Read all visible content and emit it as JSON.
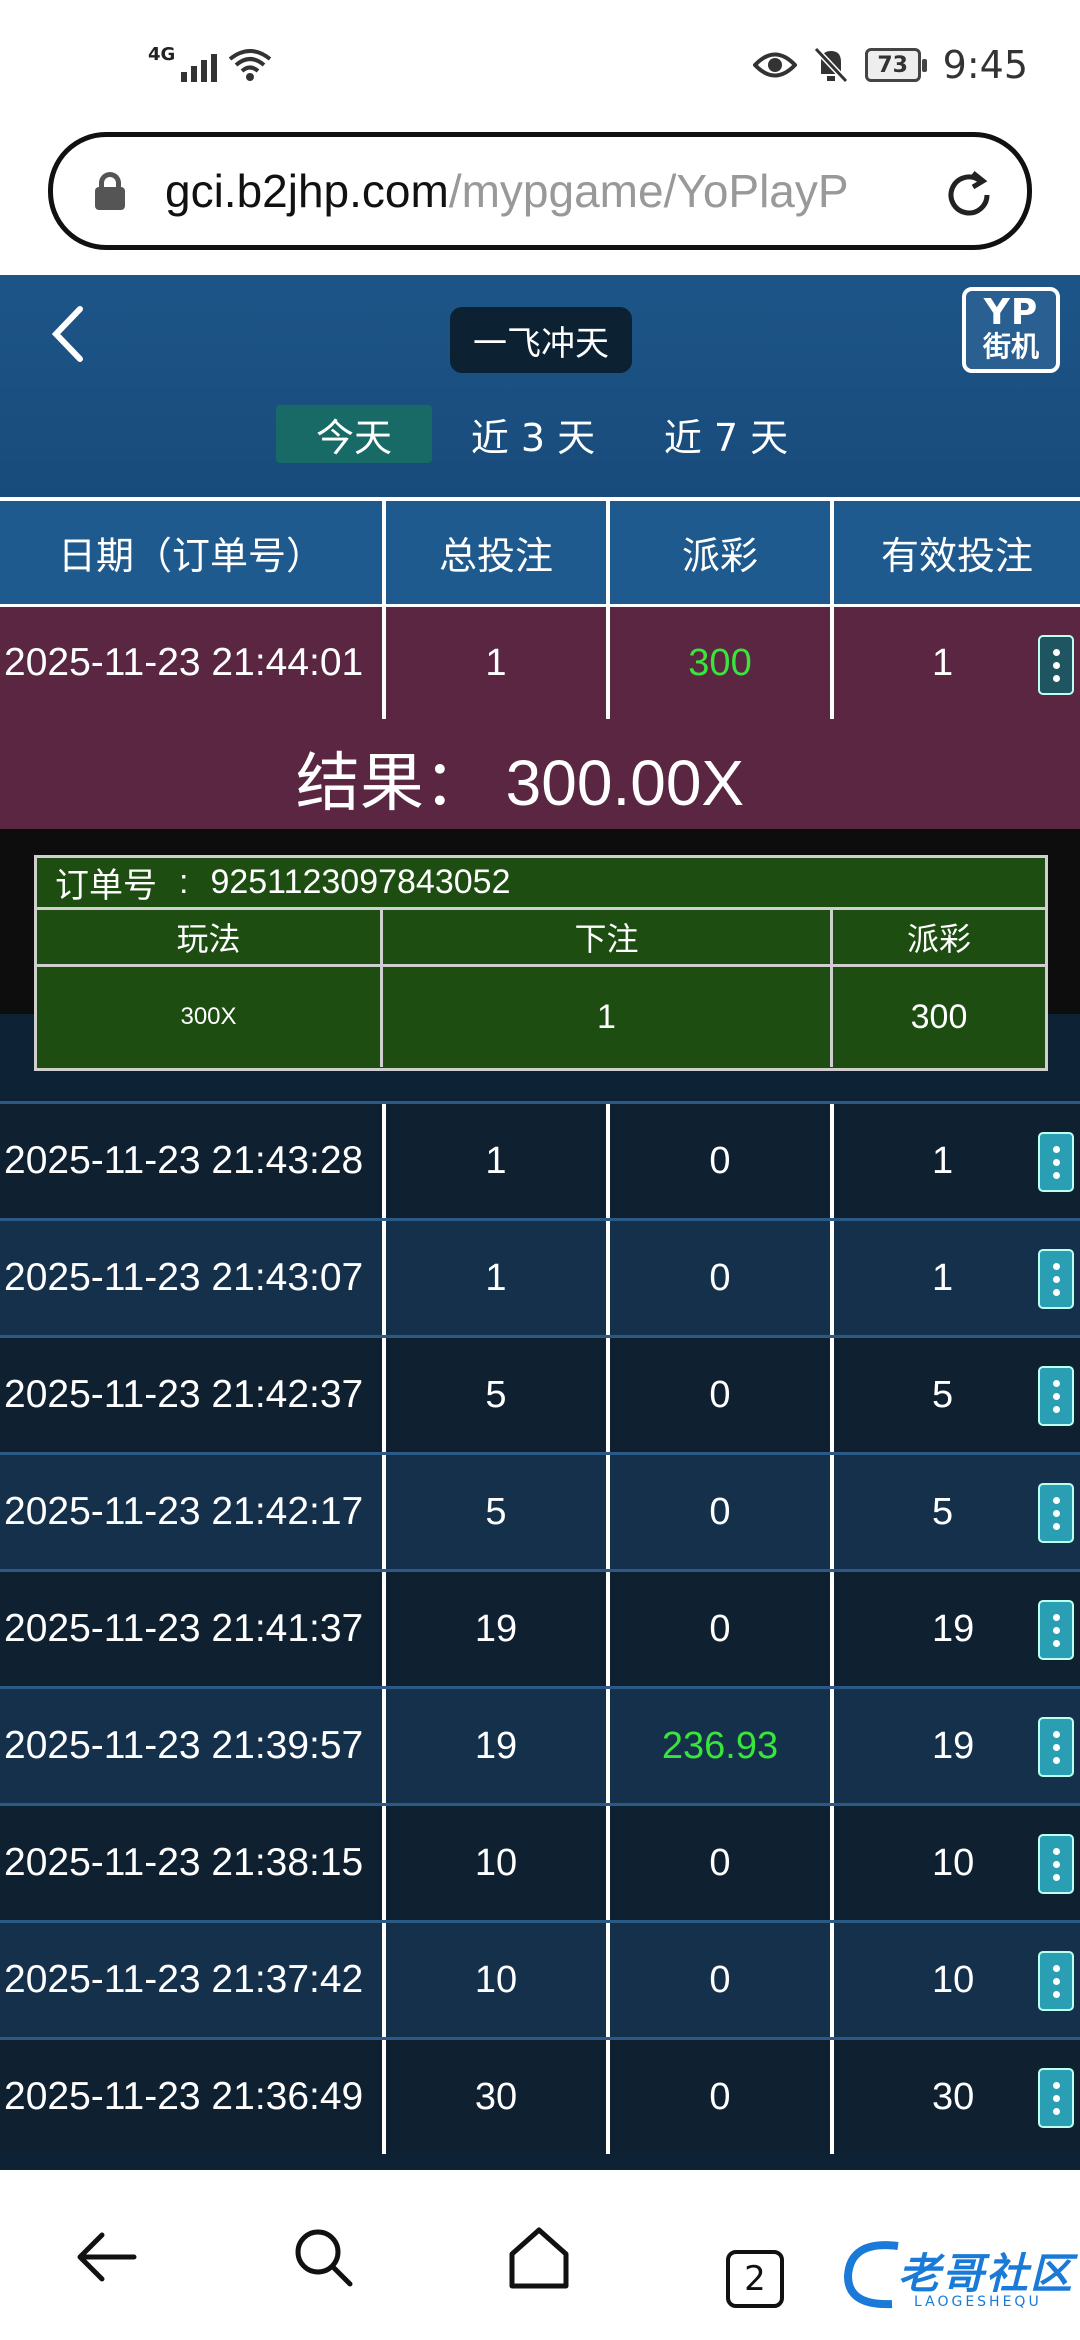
{
  "status_bar": {
    "network": "4G",
    "battery": "73",
    "time": "9:45"
  },
  "browser": {
    "url_domain": "gci.b2jhp.com",
    "url_path": "/mypgame/YoPlayP",
    "tab_count": "2"
  },
  "game": {
    "title": "一飞冲天",
    "logo_top": "YP",
    "logo_bottom": "街机",
    "tabs": [
      "今天",
      "近 3 天",
      "近 7 天"
    ],
    "columns": [
      "日期（订单号）",
      "总投注",
      "派彩",
      "有效投注"
    ],
    "expanded": {
      "date": "2025-11-23 21:44:01",
      "bet": "1",
      "payout": "300",
      "valid": "1",
      "result": "结果：  300.00X",
      "order_label": "订单号",
      "order_sep": ":",
      "order_no": "9251123097843052",
      "detail_headers": [
        "玩法",
        "下注",
        "派彩"
      ],
      "detail_row": [
        "300X",
        "1",
        "300"
      ]
    },
    "rows": [
      {
        "date": "2025-11-23 21:43:28",
        "bet": "1",
        "payout": "0",
        "valid": "1"
      },
      {
        "date": "2025-11-23 21:43:07",
        "bet": "1",
        "payout": "0",
        "valid": "1"
      },
      {
        "date": "2025-11-23 21:42:37",
        "bet": "5",
        "payout": "0",
        "valid": "5"
      },
      {
        "date": "2025-11-23 21:42:17",
        "bet": "5",
        "payout": "0",
        "valid": "5"
      },
      {
        "date": "2025-11-23 21:41:37",
        "bet": "19",
        "payout": "0",
        "valid": "19"
      },
      {
        "date": "2025-11-23 21:39:57",
        "bet": "19",
        "payout": "236.93",
        "valid": "19"
      },
      {
        "date": "2025-11-23 21:38:15",
        "bet": "10",
        "payout": "0",
        "valid": "10"
      },
      {
        "date": "2025-11-23 21:37:42",
        "bet": "10",
        "payout": "0",
        "valid": "10"
      },
      {
        "date": "2025-11-23 21:36:49",
        "bet": "30",
        "payout": "0",
        "valid": "30"
      }
    ]
  },
  "watermark": {
    "text": "老哥社区",
    "sub": "LAOGESHEQU"
  },
  "colors": {
    "header": "#1d5588",
    "win_green": "#39e53a",
    "expanded_row": "#5a2642",
    "detail_green": "#1d4d10",
    "kebab": "#2a9fb4"
  }
}
